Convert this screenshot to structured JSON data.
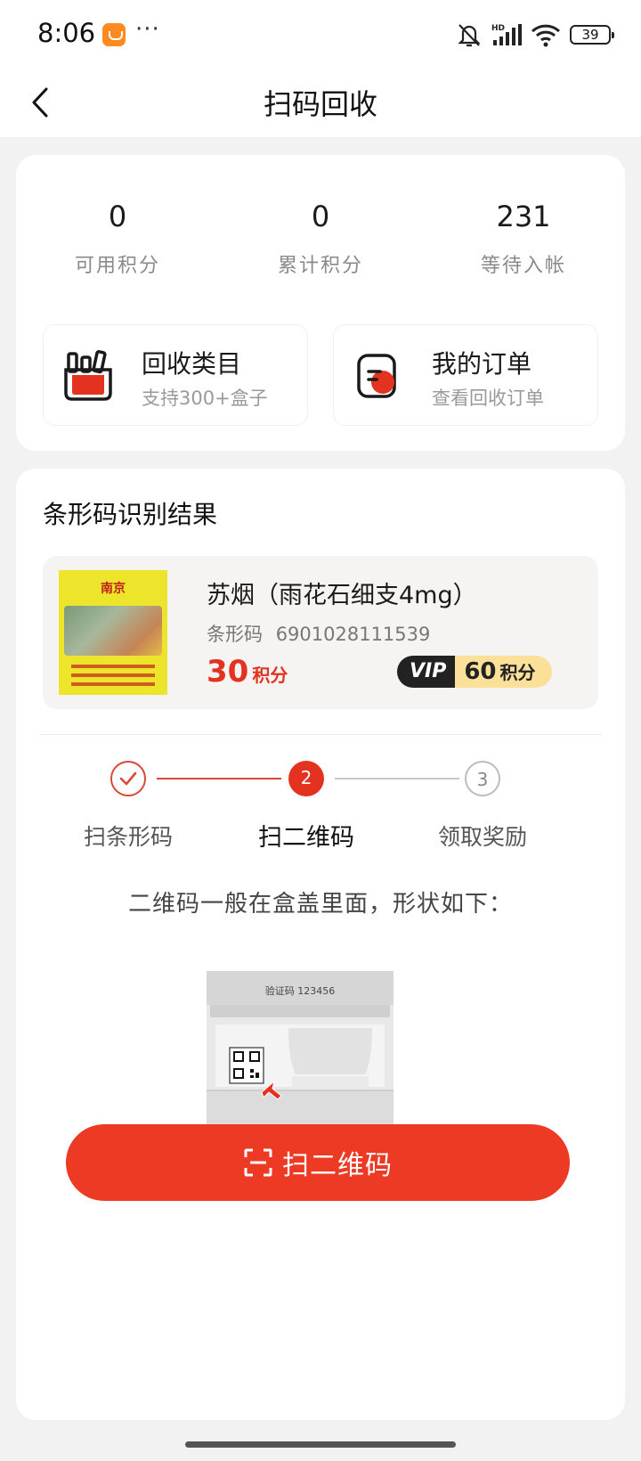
{
  "status_bar": {
    "time": "8:06",
    "dots": "···",
    "battery": "39",
    "network": "HD"
  },
  "nav": {
    "title": "扫码回收"
  },
  "stats": [
    {
      "value": "0",
      "label": "可用积分"
    },
    {
      "value": "0",
      "label": "累计积分"
    },
    {
      "value": "231",
      "label": "等待入帐"
    }
  ],
  "entries": {
    "category": {
      "title": "回收类目",
      "subtitle": "支持300+盒子"
    },
    "orders": {
      "title": "我的订单",
      "subtitle": "查看回收订单"
    }
  },
  "result": {
    "section_title": "条形码识别结果",
    "product": {
      "name": "苏烟（雨花石细支4mg）",
      "barcode_label": "条形码",
      "barcode": "6901028111539",
      "points": "30",
      "points_unit": "积分",
      "vip_tag": "VIP",
      "vip_points": "60",
      "vip_points_unit": "积分",
      "pack_logo": "南京"
    }
  },
  "steps": [
    {
      "label": "扫条形码",
      "state": "done",
      "number": "1"
    },
    {
      "label": "扫二维码",
      "state": "current",
      "number": "2"
    },
    {
      "label": "领取奖励",
      "state": "pending",
      "number": "3"
    }
  ],
  "hint": "二维码一般在盒盖里面，形状如下：",
  "illustration": {
    "code_text": "验证码 123456"
  },
  "scan_button": {
    "label": "扫二维码"
  },
  "colors": {
    "accent": "#ec3a25",
    "vip_gold": "#fbe09a"
  }
}
